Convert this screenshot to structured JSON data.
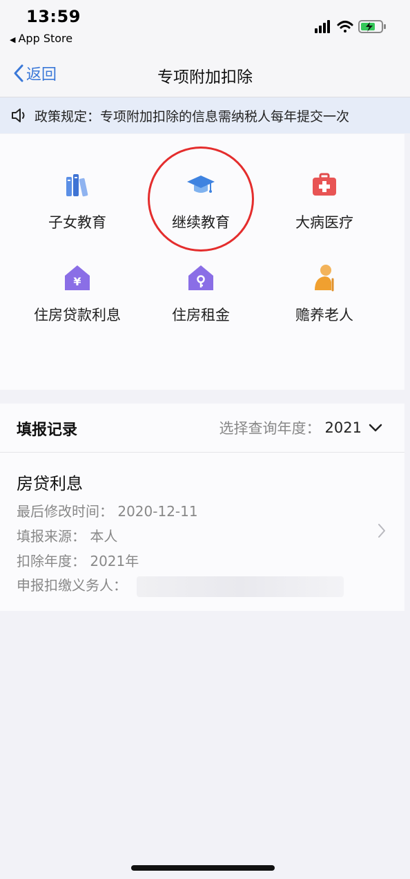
{
  "status_bar": {
    "time": "13:59",
    "back_app": "App Store"
  },
  "nav": {
    "back_label": "返回",
    "title": "专项附加扣除"
  },
  "notice": {
    "text": "政策规定：专项附加扣除的信息需纳税人每年提交一次"
  },
  "categories": [
    {
      "label": "子女教育",
      "icon": "books-icon"
    },
    {
      "label": "继续教育",
      "icon": "graduation-cap-icon"
    },
    {
      "label": "大病医疗",
      "icon": "medical-kit-icon"
    },
    {
      "label": "住房贷款利息",
      "icon": "house-yen-icon"
    },
    {
      "label": "住房租金",
      "icon": "house-key-icon"
    },
    {
      "label": "赡养老人",
      "icon": "elderly-person-icon"
    }
  ],
  "records": {
    "title": "填报记录",
    "year_prompt": "选择查询年度：",
    "year_value": "2021",
    "items": [
      {
        "title": "房贷利息",
        "last_modified": "最后修改时间：  2020-12-11",
        "source": "填报来源：  本人",
        "deduction_year": "扣除年度：  2021年",
        "withholding_agent_label": "申报扣缴义务人："
      }
    ]
  },
  "colors": {
    "accent": "#3a78d8",
    "highlight": "#e42d2d",
    "notice_bg": "#e6ecf8"
  }
}
